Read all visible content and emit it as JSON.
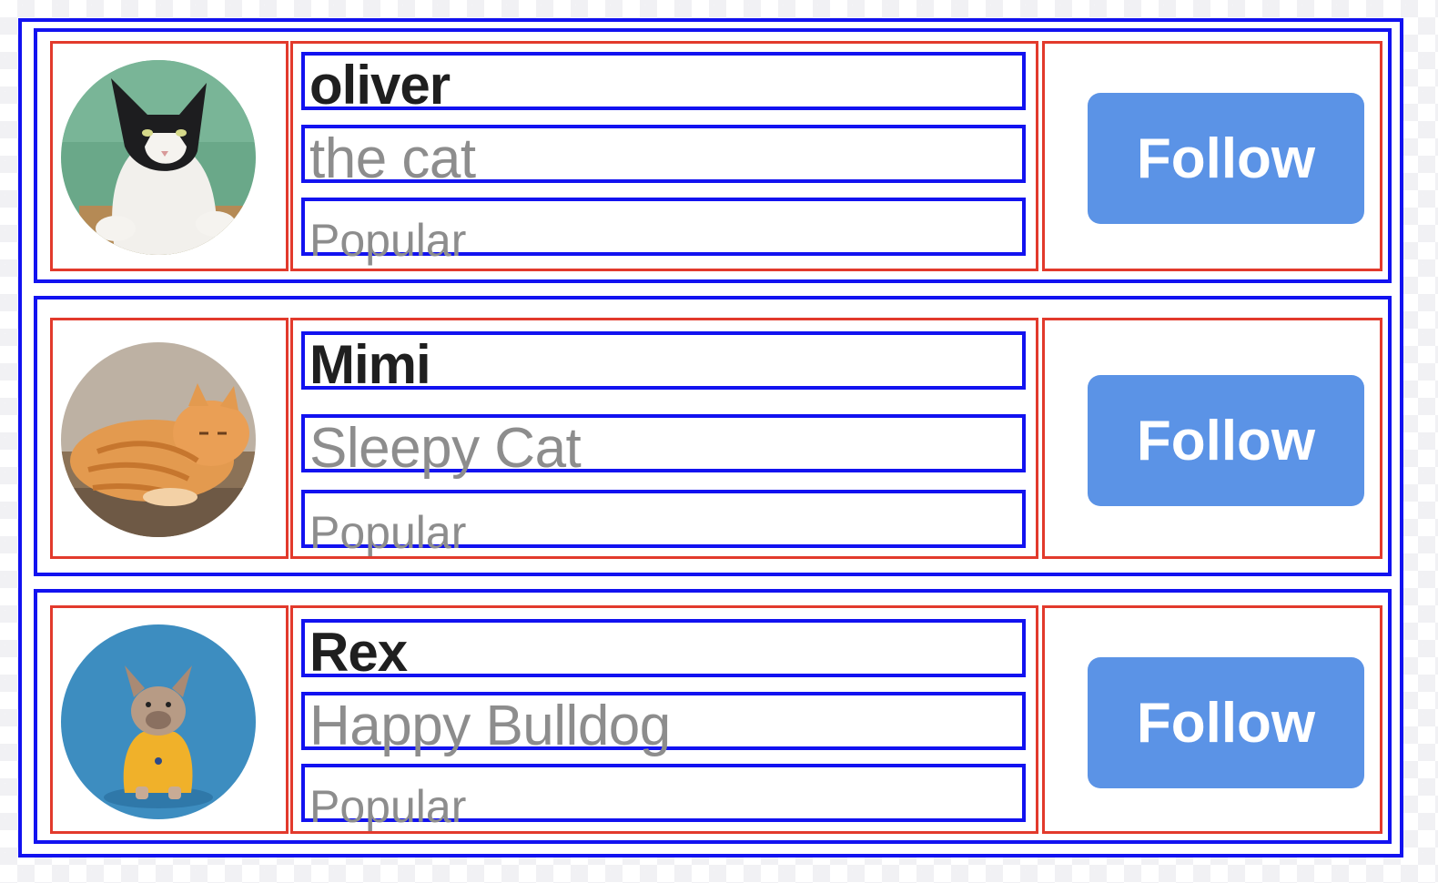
{
  "users": [
    {
      "name": "oliver",
      "description": "the cat",
      "tag": "Popular",
      "follow_label": "Follow",
      "avatar": "black-and-white-cat-photo"
    },
    {
      "name": "Mimi",
      "description": "Sleepy Cat",
      "tag": "Popular",
      "follow_label": "Follow",
      "avatar": "orange-tabby-cat-photo"
    },
    {
      "name": "Rex",
      "description": "Happy Bulldog",
      "tag": "Popular",
      "follow_label": "Follow",
      "avatar": "french-bulldog-photo"
    }
  ],
  "colors": {
    "outline_blue": "#1212f0",
    "outline_red": "#e23a2c",
    "follow_button": "#5b93e6",
    "name_text": "#1f1f1f",
    "secondary_text": "#8d8d8d"
  }
}
